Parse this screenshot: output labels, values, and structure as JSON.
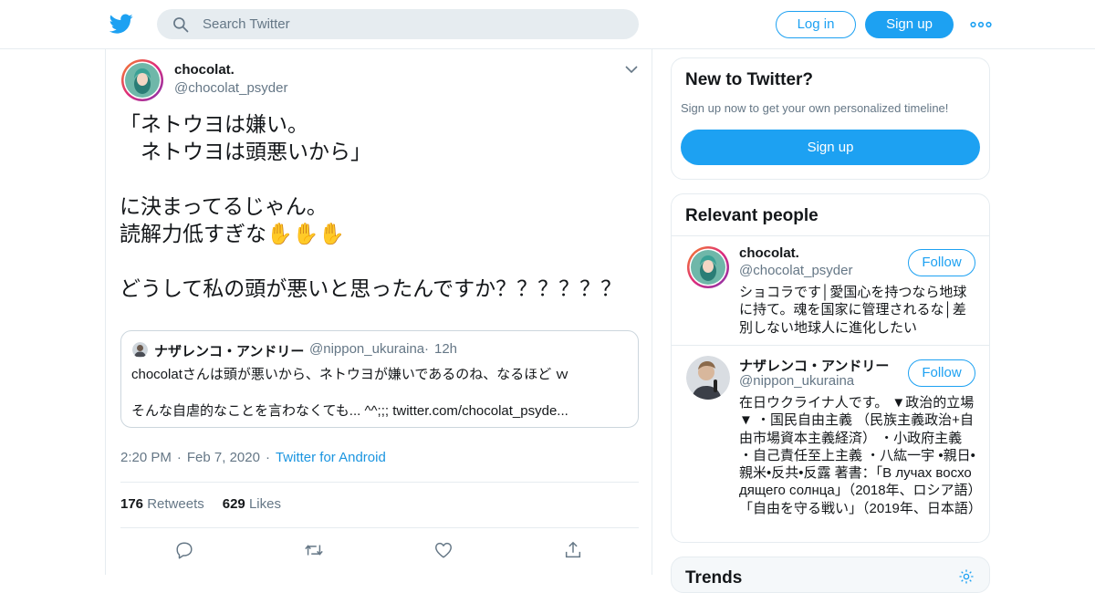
{
  "search": {
    "placeholder": "Search Twitter"
  },
  "header": {
    "login_label": "Log in",
    "signup_label": "Sign up"
  },
  "tweet": {
    "author_name": "chocolat.",
    "author_handle": "@chocolat_psyder",
    "text": "「ネトウヨは嫌い。\n　ネトウヨは頭悪いから」\n\nに決まってるじゃん。\n読解力低すぎな✋✋✋\n\nどうして私の頭が悪いと思ったんですか？？？？？？",
    "quote": {
      "author_name": "ナザレンコ・アンドリー",
      "author_handle": "@nippon_ukuraina",
      "dot": "·",
      "time": "12h",
      "line1": "chocolatさんは頭が悪いから、ネトウヨが嫌いであるのね、なるほど ｗ",
      "line2": "そんな自虐的なことを言わなくても... ^^;;; twitter.com/chocolat_psyde..."
    },
    "time": "2:20 PM",
    "date": "Feb 7, 2020",
    "source": "Twitter for Android",
    "separator": "·",
    "retweets_count": "176",
    "retweets_label": "Retweets",
    "likes_count": "629",
    "likes_label": "Likes"
  },
  "sidebar": {
    "new_card": {
      "title": "New to Twitter?",
      "subtitle": "Sign up now to get your own personalized timeline!",
      "button": "Sign up"
    },
    "relevant": {
      "title": "Relevant people",
      "people": [
        {
          "name": "chocolat.",
          "handle": "@chocolat_psyder",
          "follow": "Follow",
          "bio": "ショコラです│愛国心を持つなら地球に持て。魂を国家に管理されるな│差別しない地球人に進化したい"
        },
        {
          "name": "ナザレンコ・アンドリー",
          "handle": "@nippon_ukuraina",
          "follow": "Follow",
          "bio": "在日ウクライナ人です。 ▼政治的立場▼ ・国民自由主義 （民族主義政治+自由市場資本主義経済） ・小政府主義 ・自己責任至上主義 ・八紘一宇 •親日•親米•反共•反露 著書：「В лучах восходящего солнца」（2018年、ロシア語）「自由を守る戦い」（2019年、日本語）"
        }
      ]
    },
    "trends_title": "Trends"
  },
  "colors": {
    "brand": "#1da1f2",
    "link": "#1b95e0",
    "secondary_text": "#657786",
    "border": "#e6ecf0"
  },
  "icons": [
    "twitter-bird-icon",
    "search-icon",
    "more-dots-icon",
    "chevron-down-icon",
    "reply-icon",
    "retweet-icon",
    "like-icon",
    "share-icon",
    "gear-icon"
  ]
}
